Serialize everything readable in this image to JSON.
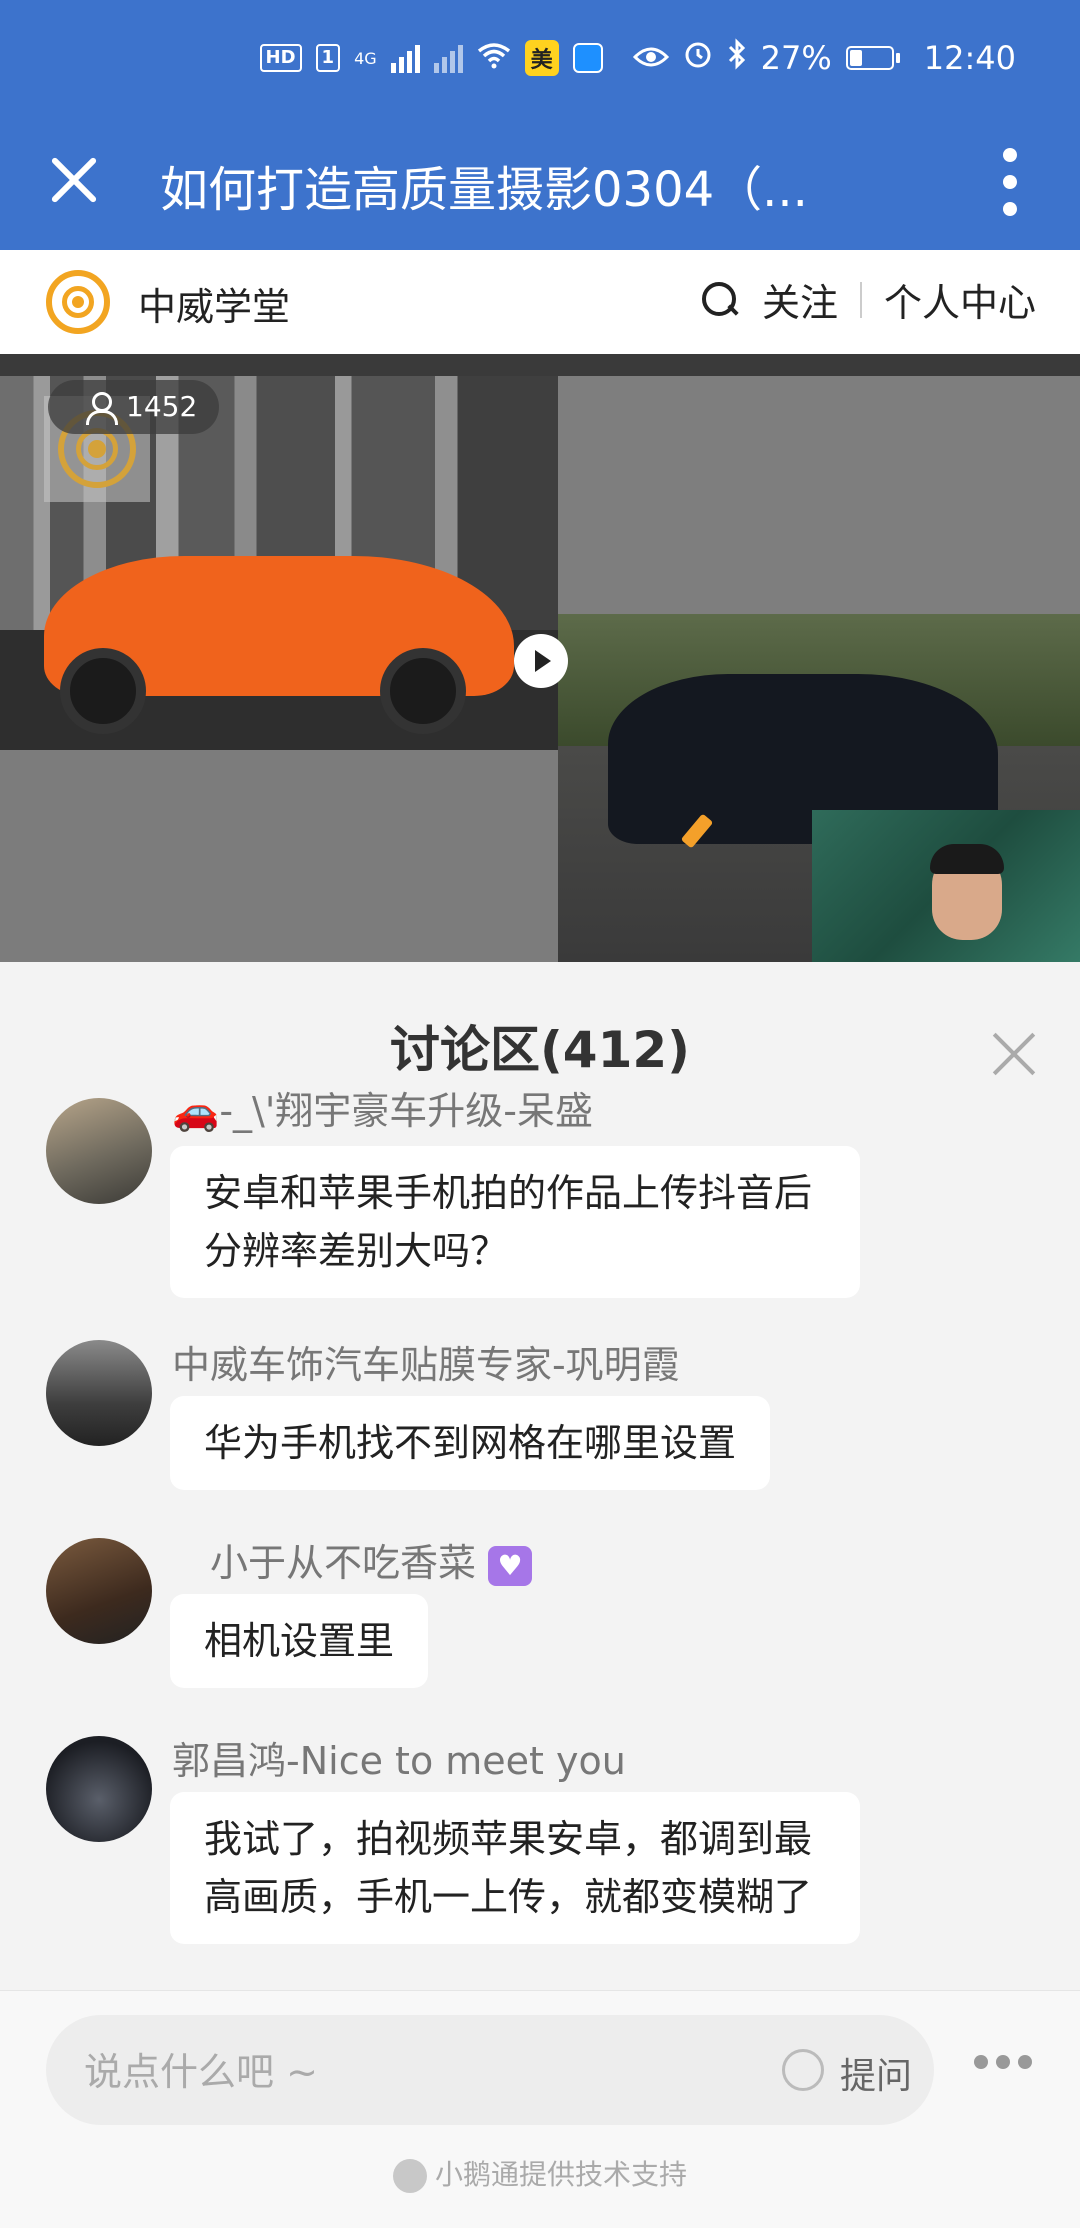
{
  "status_bar": {
    "hd_label": "HD",
    "sim_label": "1",
    "net_label": "4G",
    "sim2_label": "×",
    "meituan_label": "美",
    "battery_text": "27%",
    "time": "12:40"
  },
  "title_bar": {
    "title": "如何打造高质量摄影0304（..."
  },
  "brand_bar": {
    "name": "中威学堂",
    "follow_label": "关注",
    "profile_label": "个人中心"
  },
  "video": {
    "viewer_count": "1452"
  },
  "discussion": {
    "title": "讨论区(412)",
    "messages": [
      {
        "name": "🚗-_\\'翔宇豪车升级-呆盛",
        "text": "安卓和苹果手机拍的作品上传抖音后分辨率差别大吗？"
      },
      {
        "name": "中威车饰汽车贴膜专家-巩明霞",
        "text": "华为手机找不到网格在哪里设置"
      },
      {
        "name": "小于从不吃香菜",
        "emoji": "♥",
        "text": "相机设置里"
      },
      {
        "name": "郭昌鸿-Nice to meet you",
        "text": "我试了，拍视频苹果安卓，都调到最高画质，手机一上传，就都变模糊了"
      }
    ]
  },
  "input": {
    "placeholder": "说点什么吧 ~",
    "ask_label": "提问"
  },
  "footer": {
    "powered_by": "小鹅通提供技术支持"
  },
  "colors": {
    "header_blue": "#3d73cc",
    "brand_orange": "#f2a521",
    "bg_gray": "#f3f3f3"
  }
}
